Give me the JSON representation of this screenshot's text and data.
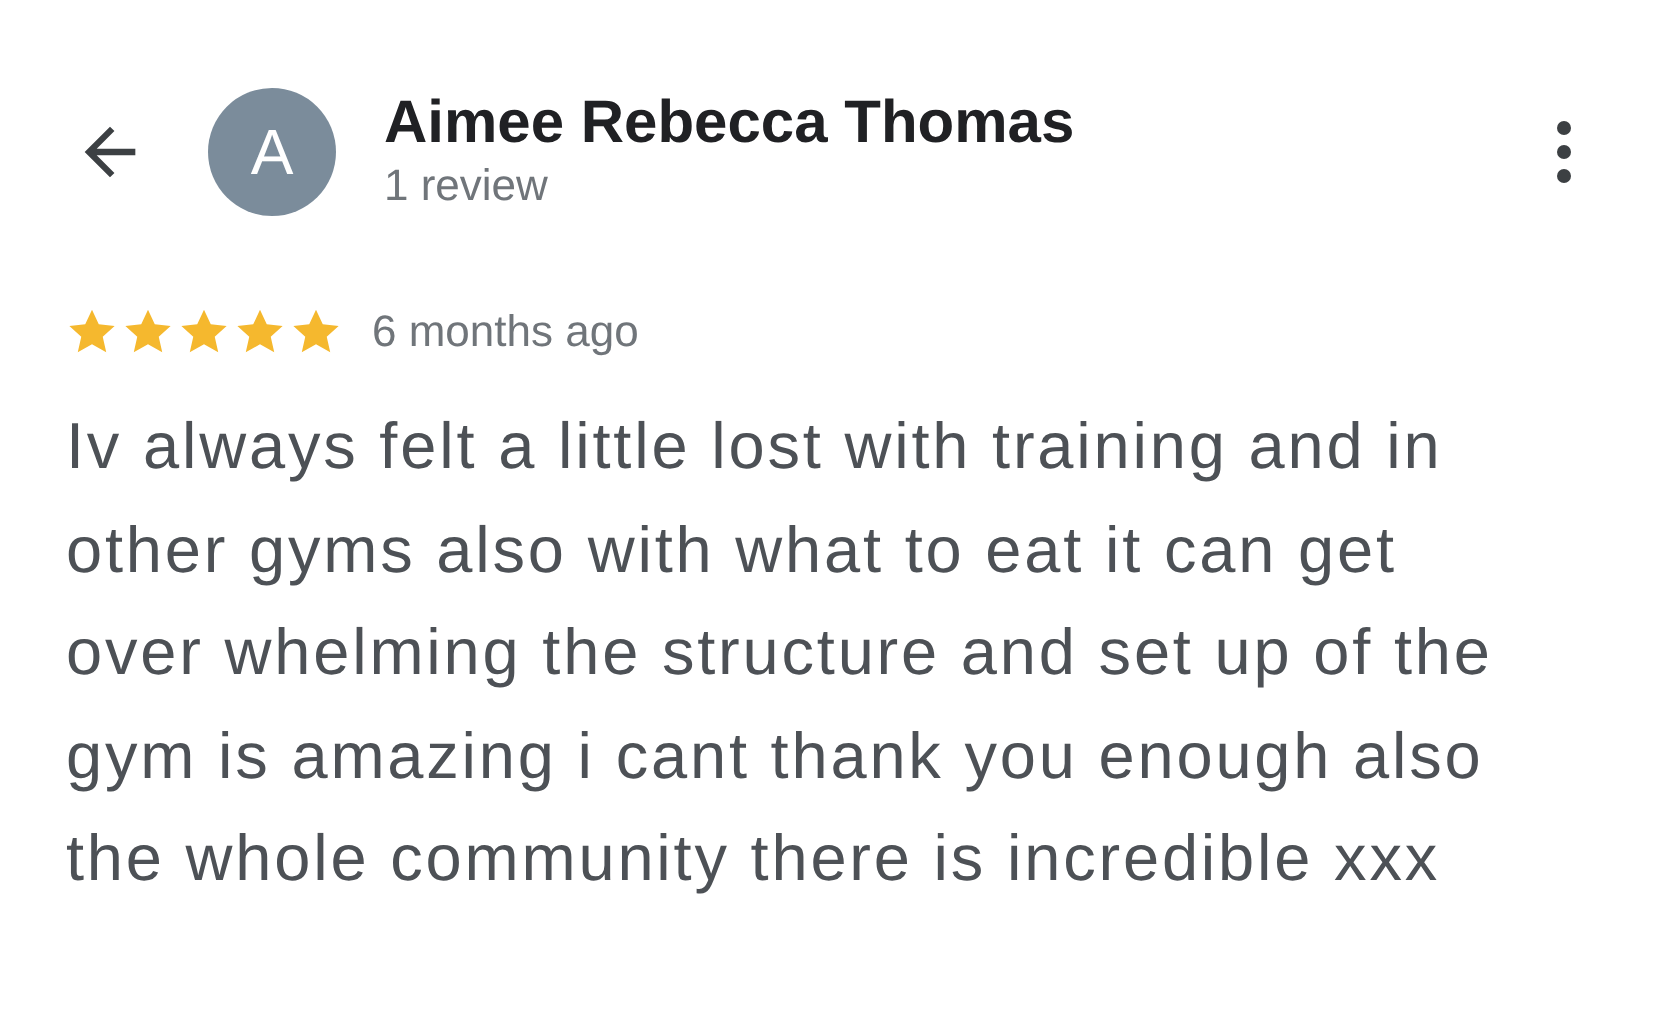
{
  "header": {
    "avatar_letter": "A",
    "name": "Aimee Rebecca Thomas",
    "review_count": "1 review"
  },
  "review": {
    "stars": 5,
    "time": "6 months ago",
    "text": "Iv always felt a little lost with training and in other gyms also with what to eat it can get over whelming the structure and set up of the gym is amazing i cant thank you enough also the whole community there is incredible xxx"
  }
}
